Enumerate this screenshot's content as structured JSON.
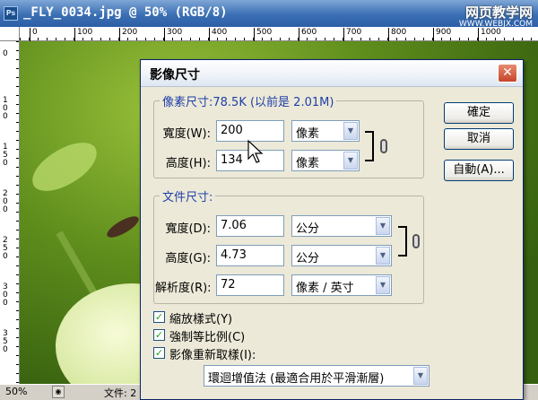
{
  "document": {
    "title": "_FLY_0034.jpg @ 50% (RGB/8)",
    "app_icon": "Ps",
    "watermark_line1": "网页教学网",
    "watermark_line2": "WWW.WEBJX.COM",
    "ruler_top_ticks": [
      "0",
      "100",
      "200",
      "300",
      "400",
      "500",
      "600",
      "700",
      "800",
      "900",
      "1000"
    ],
    "ruler_left_ticks": [
      "0",
      "1 0 0",
      "1 5 0",
      "2 0 0",
      "2 5 0",
      "3 0 0",
      "3 5 0"
    ],
    "status_zoom": "50%",
    "status_file": "文件: 2"
  },
  "dialog": {
    "title": "影像尺寸",
    "pixel_section": {
      "legend": "像素尺寸:78.5K (以前是 2.01M)",
      "width_label": "寬度(W):",
      "width_value": "200",
      "width_unit": "像素",
      "height_label": "高度(H):",
      "height_value": "134",
      "height_unit": "像素"
    },
    "doc_section": {
      "legend": "文件尺寸:",
      "width_label": "寬度(D):",
      "width_value": "7.06",
      "width_unit": "公分",
      "height_label": "高度(G):",
      "height_value": "4.73",
      "height_unit": "公分",
      "res_label": "解析度(R):",
      "res_value": "72",
      "res_unit": "像素 / 英寸"
    },
    "checkboxes": [
      {
        "label": "縮放樣式(Y)",
        "checked": true
      },
      {
        "label": "強制等比例(C)",
        "checked": true
      },
      {
        "label": "影像重新取樣(I):",
        "checked": true
      }
    ],
    "resample_method": "環迴增值法 (最適合用於平滑漸層)",
    "buttons": {
      "ok": "確定",
      "cancel": "取消",
      "auto": "自動(A)..."
    }
  }
}
